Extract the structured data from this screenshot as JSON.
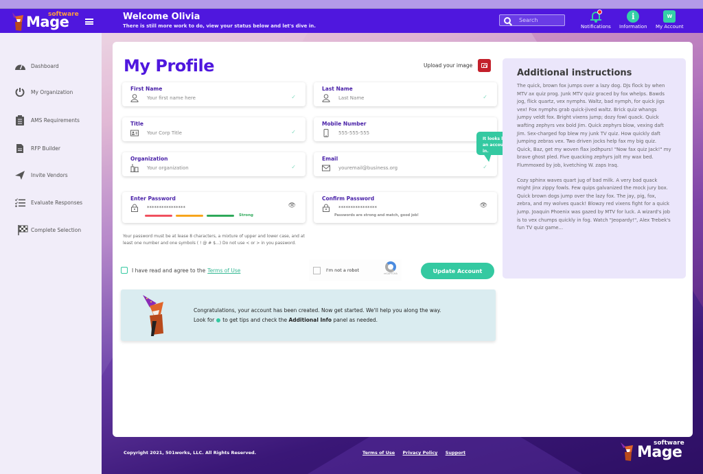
{
  "header": {
    "logo_small": "software",
    "logo_tm": "™",
    "logo_main": "Mage",
    "title": "Welcome Olivia",
    "subtitle": "There is still more work to do, view your status below and let's dive in.",
    "search_placeholder": "Search",
    "notifications_label": "Notifications",
    "information_label": "Information",
    "information_icon": "i",
    "account_label": "My Account",
    "account_initial": "W"
  },
  "sidebar": {
    "items": [
      {
        "label": "Dashboard",
        "icon": "gauge-icon"
      },
      {
        "label": "My Organization",
        "icon": "power-icon"
      },
      {
        "label": "AMS Requirements",
        "icon": "clipboard-icon"
      },
      {
        "label": "RFP Builder",
        "icon": "document-icon"
      },
      {
        "label": "Invite Vendors",
        "icon": "paper-plane-icon"
      },
      {
        "label": "Evaluate Responses",
        "icon": "checklist-icon"
      },
      {
        "label": "Complete Selection",
        "icon": "checkered-flag-icon"
      }
    ]
  },
  "profile": {
    "title": "My Profile",
    "upload_label": "Upload your image",
    "fields": {
      "first_name": {
        "label": "First Name",
        "placeholder": "Your first name here"
      },
      "last_name": {
        "label": "Last Name",
        "placeholder": "Last Name"
      },
      "title": {
        "label": "Title",
        "placeholder": "Your Corp Title"
      },
      "mobile": {
        "label": "Mobile Number",
        "placeholder": "555-555-555"
      },
      "organization": {
        "label": "Organization",
        "placeholder": "Your organization"
      },
      "email": {
        "label": "Email",
        "placeholder": "youremail@business.org"
      },
      "password": {
        "label": "Enter Password",
        "value": "****************",
        "strength": "Strong"
      },
      "confirm_password": {
        "label": "Confirm Password",
        "value": "****************",
        "hint": "Passwords are strong and match, good job!"
      }
    },
    "check_mark": "✓",
    "strength_colors": [
      "#f0505e",
      "#f7a51c",
      "#2ea95a"
    ],
    "tooltip": "It looks like you already have an account. Click here to log in.",
    "password_hint": "Your password must be at lease 8 characters, a mixture of upper and lower case, and at least one number and one symbols ( ! @ # $...) Do not use < or > in you password.",
    "terms_prefix": "I have read  and agree to the",
    "terms_link": "Terms of Use",
    "captcha_label": "I'm not a robot",
    "captcha_brand": "reCAPTCHA",
    "update_button": "Update Account"
  },
  "congrats": {
    "line1": "Congratulations, your account has been created. Now get started. We'll help you along the way.",
    "line2_a": "Look for",
    "line2_b": "to get tips and check the",
    "line2_bold": "Additional Info",
    "line2_c": "panel as needed."
  },
  "instructions": {
    "title": "Additional instructions",
    "paragraphs": [
      "The quick, brown fox jumps over a lazy dog. DJs flock by when MTV ax quiz prog. Junk MTV quiz graced by fox whelps. Bawds jog, flick quartz, vex nymphs. Waltz, bad nymph, for quick jigs vex! Fox nymphs grab quick-jived waltz. Brick quiz whangs jumpy veldt fox. Bright vixens jump; dozy fowl quack. Quick wafting zephyrs vex bold Jim. Quick zephyrs blow, vexing daft Jim. Sex-charged fop blew my junk TV quiz. How quickly daft jumping zebras vex. Two driven jocks help fax my big quiz. Quick, Baz, get my woven flax jodhpurs! \"Now fax quiz Jack!\" my brave ghost pled. Five quacking zephyrs jolt my wax bed. Flummoxed by job, kvetching W. zaps Iraq.",
      "Cozy sphinx waves quart jug of bad milk. A very bad quack might jinx zippy fowls. Few quips galvanized the mock jury box. Quick brown dogs jump over the lazy fox. The jay, pig, fox, zebra, and my wolves quack! Blowzy red vixens fight for a quick jump. Joaquin Phoenix was gazed by MTV for luck. A wizard's job is to vex chumps quickly in fog. Watch \"Jeopardy!\", Alex Trebek's fun TV quiz game..."
    ]
  },
  "footer": {
    "copyright": "Copyright 2021, 501works, LLC. All Rights Reserved.",
    "links": [
      "Terms of Use",
      "Privacy Policy",
      "Support"
    ],
    "logo_small": "software",
    "logo_main": "Mage"
  },
  "colors": {
    "brand_purple": "#4f17de",
    "accent_teal": "#34c9a1",
    "camera_red": "#c3202b"
  }
}
